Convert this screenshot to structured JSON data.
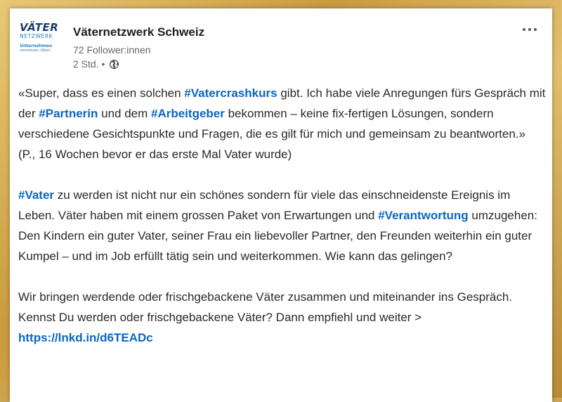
{
  "post": {
    "author": {
      "logo": {
        "brand": "VÄTER",
        "sub": "NETZWERK",
        "tagline_1": "Unternehmen",
        "tagline_2": "vernetzen Väter"
      },
      "name": "Väternetzwerk Schweiz",
      "followers": "72 Follower:innen",
      "time": "2 Std. •",
      "visibility_icon": "globe-icon"
    },
    "more_icon": "ellipsis-icon",
    "paragraph_1": {
      "t1": "«Super, dass es einen solchen ",
      "h1": "#Vatercrashkurs",
      "t2": " gibt. Ich habe viele Anregungen fürs Gespräch mit der ",
      "h2": "#Partnerin",
      "t3": " und dem ",
      "h3": "#Arbeitgeber",
      "t4": " bekommen – keine fix-fertigen Lösungen, sondern verschiedene Gesichtspunkte und Fragen, die es gilt für mich und gemeinsam zu beantworten.»"
    },
    "attribution": "(P., 16 Wochen bevor er das erste Mal Vater wurde)",
    "paragraph_2": {
      "h1": "#Vater",
      "t1": " zu werden ist nicht nur ein schönes sondern für viele das einschneidenste Ereignis im Leben. Väter haben mit einem grossen Paket von Erwartungen und ",
      "h2": "#Verantwortung",
      "t2": " umzugehen: Den Kindern ein guter Vater, seiner Frau ein liebevoller Partner, den Freunden weiterhin ein guter Kumpel – und im Job erfüllt tätig sein und weiterkommen. Wie kann das gelingen?"
    },
    "paragraph_3": {
      "t1": "Wir bringen werdende oder frischgebackene Väter zusammen und miteinander ins Gespräch. Kennst Du werden oder frischgebackene Väter? Dann empfiehl und weiter > ",
      "link": "https://lnkd.in/d6TEADc"
    }
  },
  "colors": {
    "hashtag": "#0a66c2",
    "frame": "#c99b3e",
    "logo_dark": "#1e3a6e",
    "logo_light": "#2e7fc1"
  }
}
